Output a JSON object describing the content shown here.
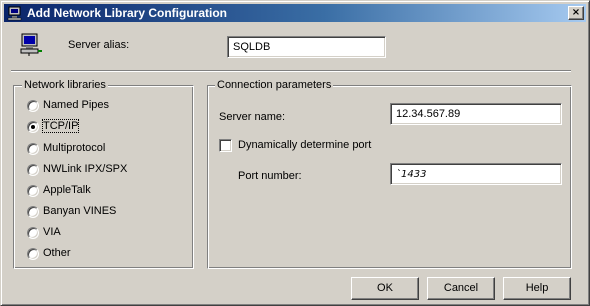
{
  "window": {
    "title": "Add Network Library Configuration",
    "close_glyph": "×"
  },
  "alias": {
    "label": "Server alias:",
    "value": "SQLDB",
    "icon": "computer-icon"
  },
  "network_libraries": {
    "title": "Network libraries",
    "selected": "TCP/IP",
    "items": [
      {
        "label": "Named Pipes",
        "checked": false
      },
      {
        "label": "TCP/IP",
        "checked": true
      },
      {
        "label": "Multiprotocol",
        "checked": false
      },
      {
        "label": "NWLink IPX/SPX",
        "checked": false
      },
      {
        "label": "AppleTalk",
        "checked": false
      },
      {
        "label": "Banyan VINES",
        "checked": false
      },
      {
        "label": "VIA",
        "checked": false
      },
      {
        "label": "Other",
        "checked": false
      }
    ]
  },
  "connection": {
    "title": "Connection parameters",
    "server_name_label": "Server name:",
    "server_name_value": "12.34.567.89",
    "dynamic_port_label": "Dynamically determine port",
    "dynamic_port_checked": false,
    "port_label": "Port number:",
    "port_value": "`1433"
  },
  "buttons": {
    "ok": "OK",
    "cancel": "Cancel",
    "help": "Help"
  },
  "colors": {
    "face": "#d4d0c8",
    "title_start": "#0a246a",
    "title_end": "#a6caf0"
  }
}
